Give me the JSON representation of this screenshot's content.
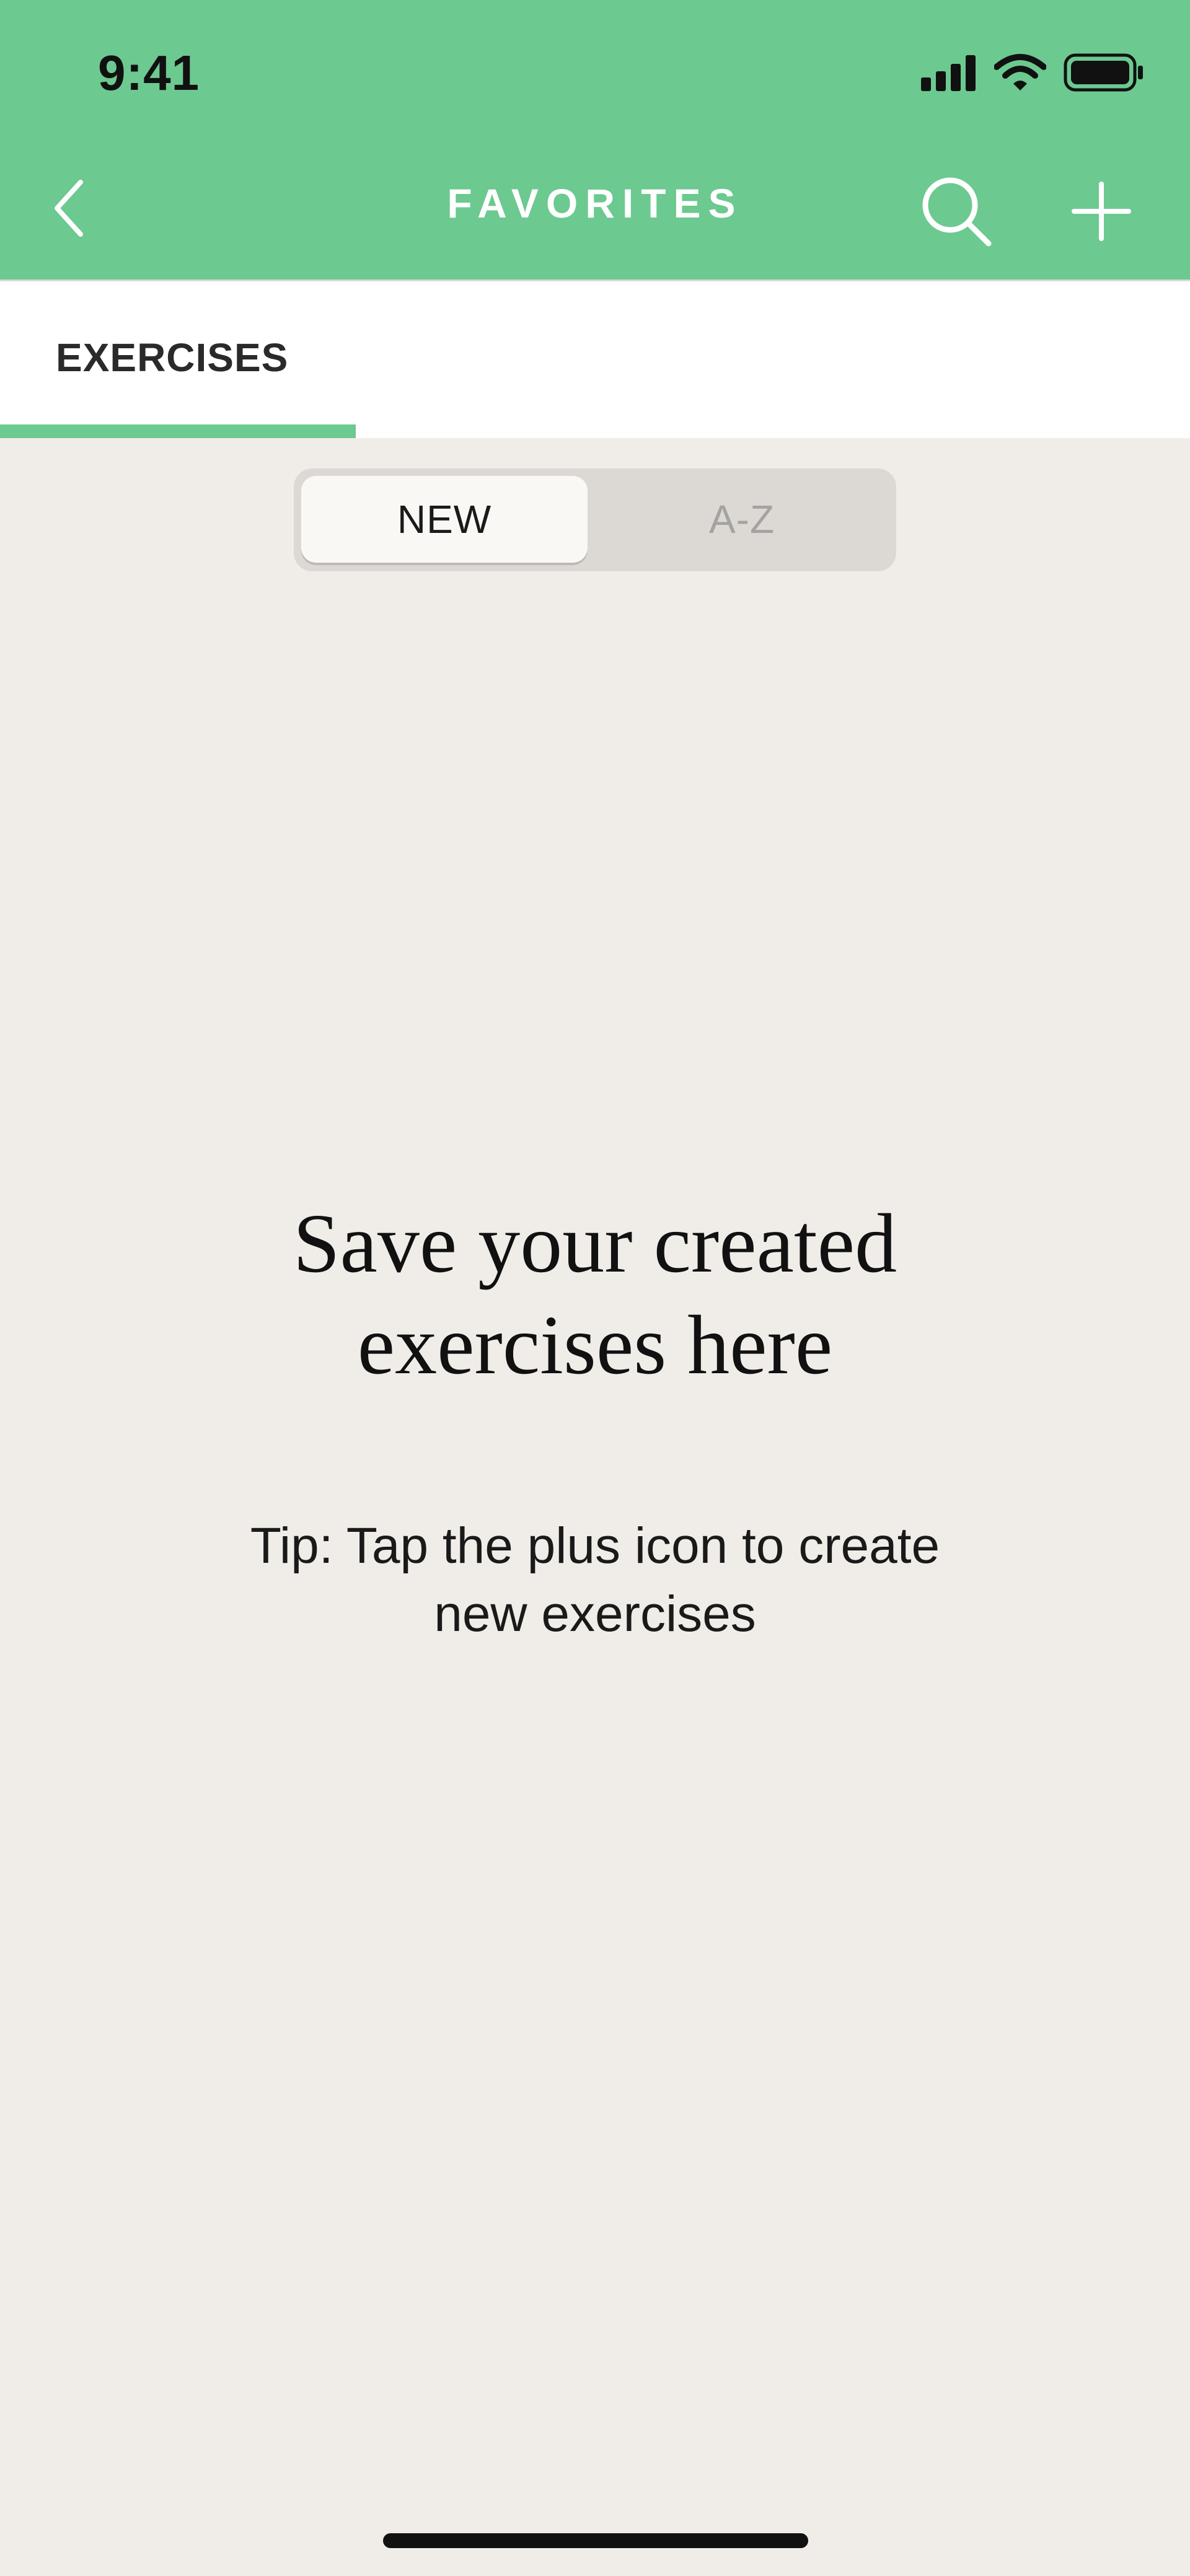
{
  "status_bar": {
    "time": "9:41",
    "icons": [
      "signal-icon",
      "wifi-icon",
      "battery-icon"
    ]
  },
  "nav": {
    "title": "FAVORITES",
    "back_icon": "chevron-left-icon",
    "search_icon": "search-icon",
    "add_icon": "plus-icon"
  },
  "tabs": [
    {
      "label": "EXERCISES",
      "active": true
    }
  ],
  "sort_toggle": {
    "options": [
      "NEW",
      "A-Z"
    ],
    "selected": "NEW"
  },
  "empty_state": {
    "heading_line1": "Save your created",
    "heading_line2": "exercises here",
    "tip_line1": "Tip: Tap the plus icon to create",
    "tip_line2": "new exercises"
  },
  "colors": {
    "accent": "#6cc990",
    "background": "#f0ede9",
    "toggle_track": "#dcd9d5",
    "toggle_selected": "#faf8f5"
  }
}
